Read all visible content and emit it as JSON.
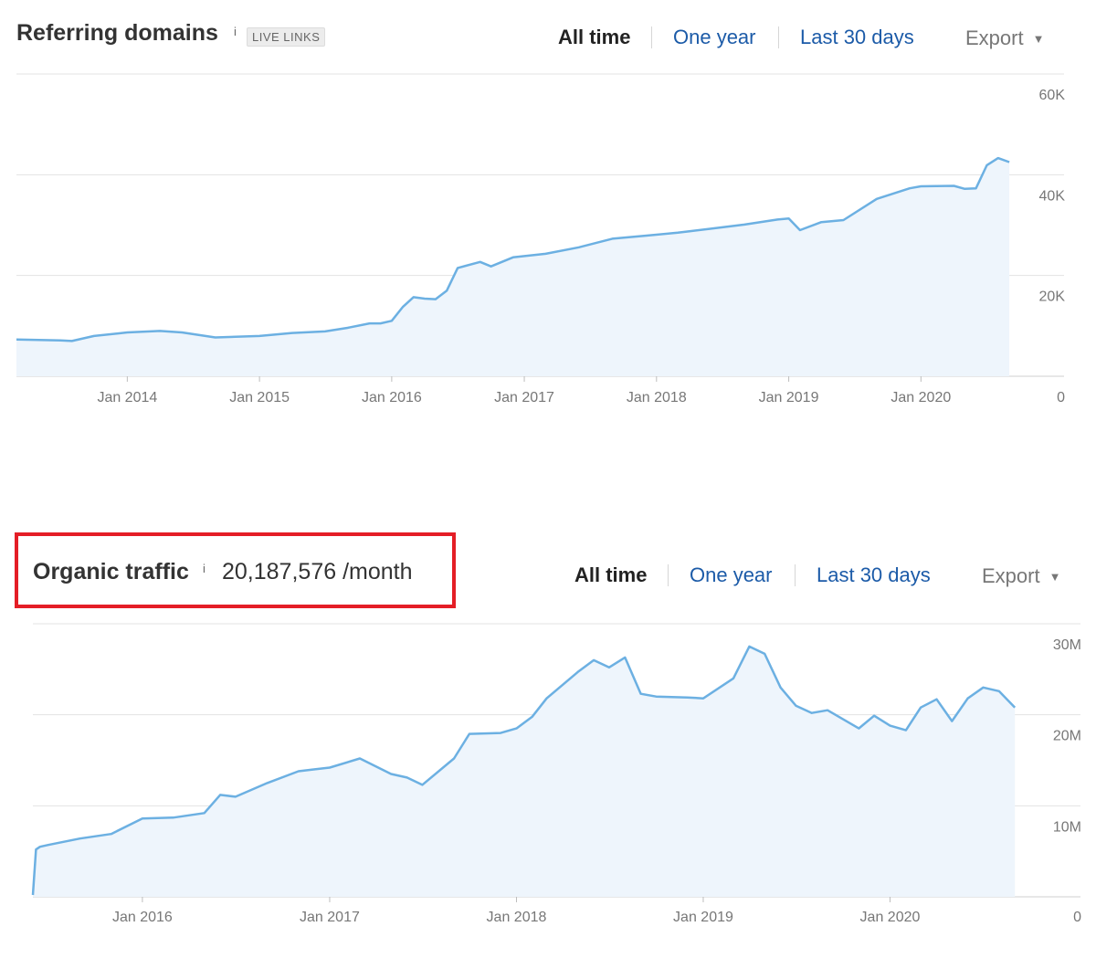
{
  "panels": [
    {
      "title": "Referring domains",
      "info_icon": "i",
      "badge": "LIVE LINKS",
      "metric": "",
      "ranges": [
        {
          "label": "All time",
          "active": true
        },
        {
          "label": "One year",
          "active": false
        },
        {
          "label": "Last 30 days",
          "active": false
        }
      ],
      "export_label": "Export",
      "export_icon": "caret-down-icon",
      "highlighted": false
    },
    {
      "title": "Organic traffic",
      "info_icon": "i",
      "badge": "",
      "metric": "20,187,576 /month",
      "ranges": [
        {
          "label": "All time",
          "active": true
        },
        {
          "label": "One year",
          "active": false
        },
        {
          "label": "Last 30 days",
          "active": false
        }
      ],
      "export_label": "Export",
      "export_icon": "caret-down-icon",
      "highlighted": true
    }
  ],
  "colors": {
    "line": "#6cb0e2",
    "area": "#eef5fc",
    "grid": "#e3e3e3",
    "highlight": "#e41e26",
    "link": "#1c5ba8"
  },
  "chart_data": [
    {
      "type": "area",
      "title": "Referring domains",
      "x_ticks": [
        "Jan 2014",
        "Jan 2015",
        "Jan 2016",
        "Jan 2017",
        "Jan 2018",
        "Jan 2019",
        "Jan 2020"
      ],
      "y_ticks": [
        "0",
        "20K",
        "40K",
        "60K"
      ],
      "ylim": [
        0,
        60000
      ],
      "xlim": [
        "2013-03-01",
        "2020-10-01"
      ],
      "y_axis_side": "right",
      "grid": true,
      "series": [
        {
          "x": [
            "2013-03-01",
            "2013-05-01",
            "2013-07-01",
            "2013-08-01",
            "2013-10-01",
            "2014-01-01",
            "2014-04-01",
            "2014-06-01",
            "2014-09-01",
            "2015-01-01",
            "2015-04-01",
            "2015-07-01",
            "2015-09-01",
            "2015-11-01",
            "2015-12-01",
            "2016-01-01",
            "2016-02-01",
            "2016-03-01",
            "2016-04-01",
            "2016-05-01",
            "2016-06-01",
            "2016-07-01",
            "2016-09-01",
            "2016-10-01",
            "2016-12-01",
            "2017-03-01",
            "2017-06-01",
            "2017-09-01",
            "2017-12-01",
            "2018-03-01",
            "2018-06-01",
            "2018-09-01",
            "2018-12-01",
            "2019-01-01",
            "2019-02-01",
            "2019-04-01",
            "2019-06-01",
            "2019-09-01",
            "2019-12-01",
            "2020-01-01",
            "2020-04-01",
            "2020-05-01",
            "2020-06-01",
            "2020-07-01",
            "2020-08-01",
            "2020-09-01"
          ],
          "values": [
            7300,
            7200,
            7100,
            7000,
            8000,
            8700,
            9000,
            8700,
            7700,
            8000,
            8600,
            8900,
            9600,
            10500,
            10500,
            11000,
            13800,
            15700,
            15400,
            15300,
            17000,
            21500,
            22700,
            21800,
            23600,
            24300,
            25600,
            27300,
            27900,
            28500,
            29300,
            30100,
            31100,
            31300,
            29000,
            30600,
            31000,
            35200,
            37300,
            37700,
            37800,
            37200,
            37300,
            41900,
            43300,
            42500
          ]
        }
      ]
    },
    {
      "type": "area",
      "title": "Organic traffic",
      "x_ticks": [
        "Jan 2016",
        "Jan 2017",
        "Jan 2018",
        "Jan 2019",
        "Jan 2020"
      ],
      "y_ticks": [
        "0",
        "10M",
        "20M",
        "30M"
      ],
      "ylim": [
        0,
        30000000
      ],
      "xlim": [
        "2015-06-01",
        "2020-10-01"
      ],
      "y_axis_side": "right",
      "grid": true,
      "series": [
        {
          "x": [
            "2015-06-01",
            "2015-06-07",
            "2015-06-15",
            "2015-07-01",
            "2015-09-01",
            "2015-11-01",
            "2016-01-01",
            "2016-03-01",
            "2016-05-01",
            "2016-06-01",
            "2016-07-01",
            "2016-09-01",
            "2016-11-01",
            "2016-12-01",
            "2017-01-01",
            "2017-03-01",
            "2017-05-01",
            "2017-06-01",
            "2017-07-01",
            "2017-09-01",
            "2017-10-01",
            "2017-12-01",
            "2018-01-01",
            "2018-02-01",
            "2018-03-01",
            "2018-05-01",
            "2018-06-01",
            "2018-07-01",
            "2018-08-01",
            "2018-09-01",
            "2018-10-01",
            "2018-12-01",
            "2019-01-01",
            "2019-03-01",
            "2019-04-01",
            "2019-05-01",
            "2019-06-01",
            "2019-07-01",
            "2019-08-01",
            "2019-09-01",
            "2019-11-01",
            "2019-12-01",
            "2020-01-01",
            "2020-02-01",
            "2020-03-01",
            "2020-04-01",
            "2020-05-01",
            "2020-06-01",
            "2020-07-01",
            "2020-08-01",
            "2020-09-01"
          ],
          "values": [
            200000,
            5200000,
            5500000,
            5700000,
            6400000,
            6900000,
            8600000,
            8700000,
            9200000,
            11200000,
            11000000,
            12500000,
            13800000,
            14000000,
            14200000,
            15200000,
            13500000,
            13100000,
            12300000,
            15200000,
            17900000,
            18000000,
            18500000,
            19800000,
            21800000,
            24700000,
            26000000,
            25200000,
            26300000,
            22300000,
            22000000,
            21900000,
            21800000,
            24000000,
            27500000,
            26700000,
            23000000,
            21000000,
            20200000,
            20500000,
            18500000,
            19900000,
            18800000,
            18300000,
            20800000,
            21700000,
            19300000,
            21800000,
            23000000,
            22600000,
            20800000
          ]
        }
      ]
    }
  ]
}
